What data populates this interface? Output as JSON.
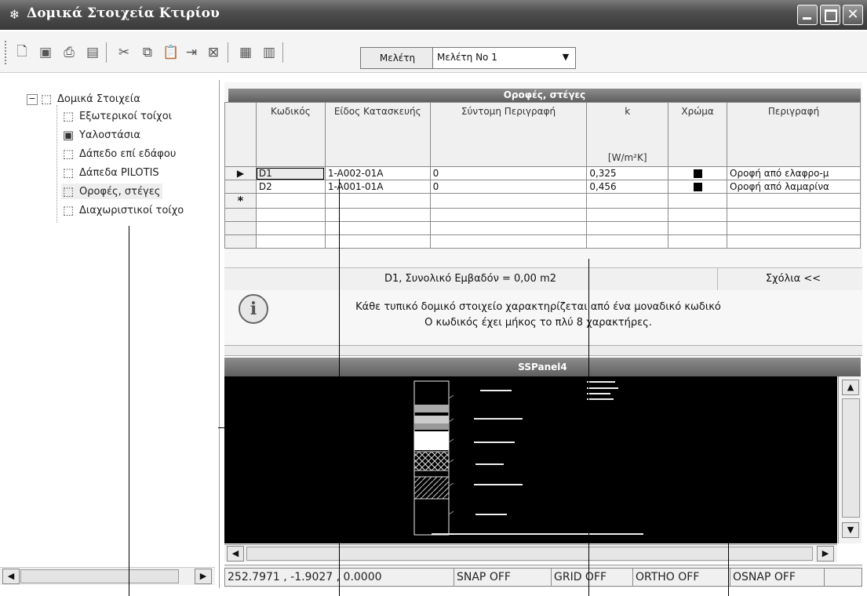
{
  "window": {
    "title": "Δομικά Στοιχεία Κτιρίου",
    "app_icon": "snowflake-icon",
    "buttons": [
      "minimize-icon",
      "maximize-icon",
      "close-icon"
    ]
  },
  "toolbar": {
    "icons": [
      "new-file-icon",
      "save-icon",
      "print-icon",
      "preview-icon",
      "cut-icon",
      "copy-icon",
      "paste-icon",
      "import-icon",
      "excel-export-icon",
      "grid-icon",
      "list-icon"
    ],
    "study_button_label": "Μελέτη",
    "study_select_value": "Μελέτη No 1"
  },
  "tree": {
    "root": "Δομικά Στοιχεία",
    "items": [
      {
        "label": "Εξωτερικοί τοίχοι",
        "icon": "wall-icon"
      },
      {
        "label": "Υαλοστάσια",
        "icon": "window-icon"
      },
      {
        "label": "Δάπεδο επί εδάφου",
        "icon": "floor-icon"
      },
      {
        "label": "Δάπεδα PILOTIS",
        "icon": "pilotis-icon"
      },
      {
        "label": "Οροφές, στέγες",
        "icon": "roof-icon"
      },
      {
        "label": "Διαχωριστικοί τοίχο",
        "icon": "partition-icon"
      }
    ],
    "selected_index": 4,
    "collapse_glyph": "−"
  },
  "grid": {
    "title": "Οροφές, στέγες",
    "columns": [
      "Κωδικός",
      "Είδος Κατασκευής",
      "Σύντομη Περιγραφή",
      "k",
      "Χρώμα",
      "Περιγραφή"
    ],
    "k_unit": "[W/m²K]",
    "rows": [
      {
        "code": "D1",
        "type": "1-A002-01A",
        "short": "0",
        "k": "0,325",
        "desc": "Οροφή από ελαφρο-μ"
      },
      {
        "code": "D2",
        "type": "1-A001-01A",
        "short": "0",
        "k": "0,456",
        "desc": "Οροφή από λαμαρίνα"
      }
    ],
    "new_row_marker": "*",
    "current_row_marker": "▶",
    "swatch_color": "#000000",
    "summary": "D1, Συνολικό Εμβαδόν = 0,00 m2",
    "comments_button": "Σχόλια <<",
    "info_lines": [
      "Κάθε τυπικό δομικό στοιχείο χαρακτηρίζεται από ένα μοναδικό κωδικό",
      "Ο κωδικός έχει μήκος το πλύ 8 χαρακτήρες."
    ]
  },
  "panel": {
    "title": "SSPanel4"
  },
  "status": {
    "coords": "252.7971 , -1.9027 , 0.0000",
    "snap": "SNAP OFF",
    "grid": "GRID OFF",
    "ortho": "ORTHO OFF",
    "osnap": "OSNAP OFF"
  }
}
